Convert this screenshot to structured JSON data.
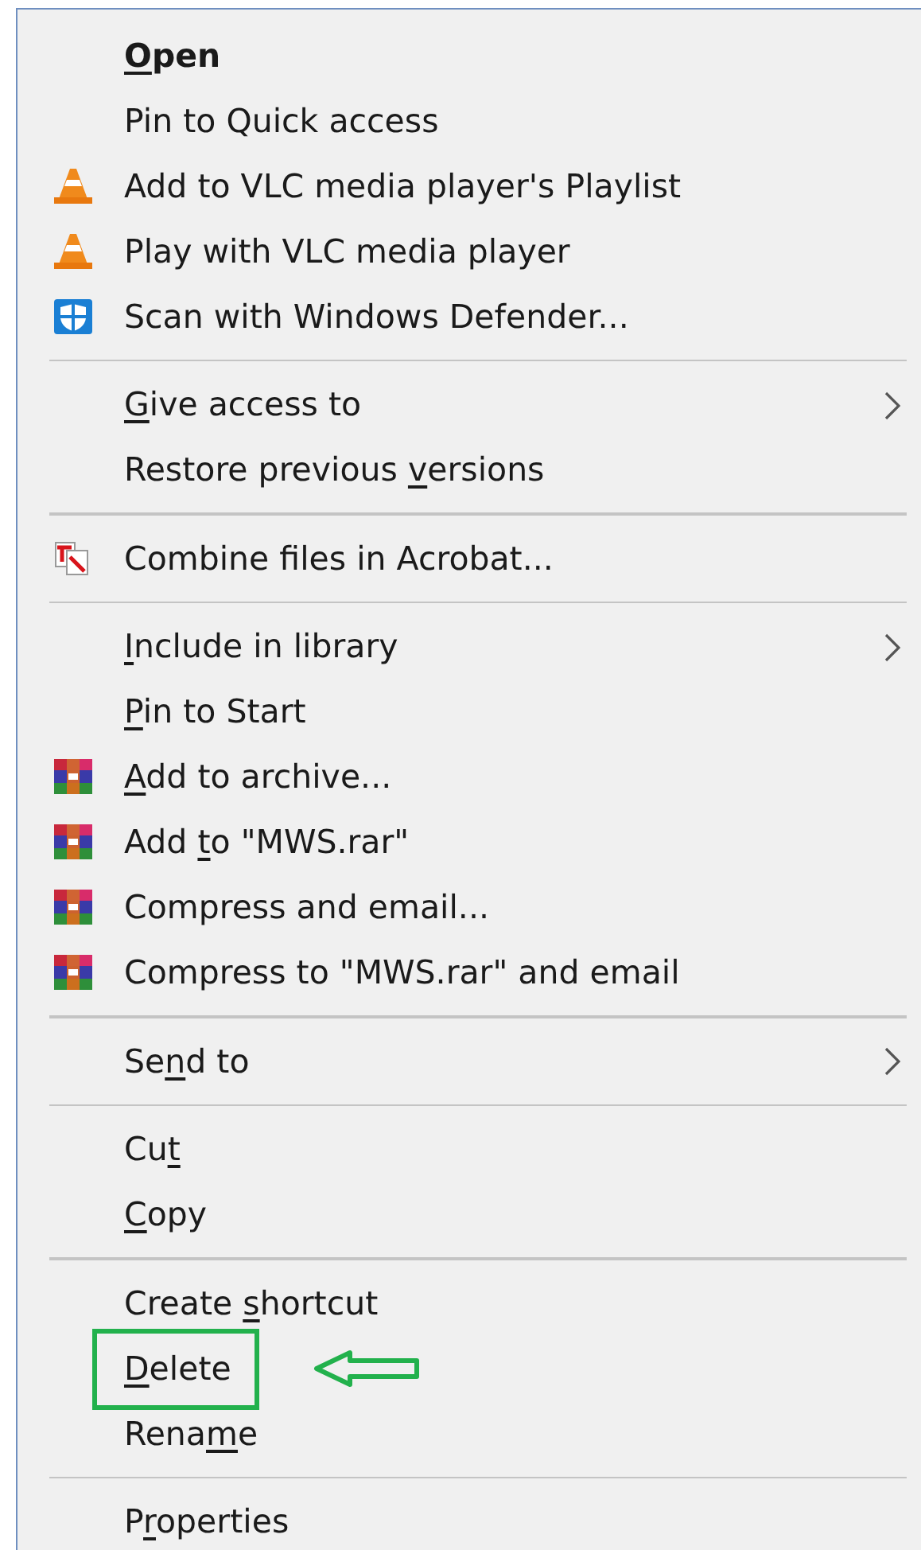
{
  "menu": {
    "groups": [
      {
        "items": [
          {
            "label": [
              {
                "text": "O",
                "underlined": true
              },
              {
                "text": "pen",
                "underlined": false
              }
            ],
            "bold": true,
            "submenu": false,
            "marked": false
          },
          {
            "label": [
              {
                "text": "Pin to Quick access",
                "underlined": false
              }
            ],
            "bold": false,
            "submenu": false,
            "marked": false
          },
          {
            "kind": "vlc",
            "label": [
              {
                "text": "Add to VLC media player's Playlist",
                "underlined": false
              }
            ],
            "bold": false,
            "submenu": false,
            "marked": false
          },
          {
            "kind": "vlc",
            "label": [
              {
                "text": "Play with VLC media player",
                "underlined": false
              }
            ],
            "bold": false,
            "submenu": false,
            "marked": false
          },
          {
            "kind": "defender",
            "label": [
              {
                "text": "Scan with Windows Defender...",
                "underlined": false
              }
            ],
            "bold": false,
            "submenu": false,
            "marked": false
          }
        ]
      },
      {
        "items": [
          {
            "label": [
              {
                "text": "G",
                "underlined": true
              },
              {
                "text": "ive access to",
                "underlined": false
              }
            ],
            "bold": false,
            "submenu": true,
            "marked": false
          },
          {
            "label": [
              {
                "text": "Restore previous ",
                "underlined": false
              },
              {
                "text": "v",
                "underlined": true
              },
              {
                "text": "ersions",
                "underlined": false
              }
            ],
            "bold": false,
            "submenu": false,
            "marked": false
          }
        ]
      },
      {
        "items": [
          {
            "kind": "acrobat",
            "label": [
              {
                "text": "Combine files in Acrobat...",
                "underlined": false
              }
            ],
            "bold": false,
            "submenu": false,
            "marked": false
          }
        ]
      },
      {
        "items": [
          {
            "label": [
              {
                "text": "I",
                "underlined": true
              },
              {
                "text": "nclude in library",
                "underlined": false
              }
            ],
            "bold": false,
            "submenu": true,
            "marked": false
          },
          {
            "label": [
              {
                "text": "P",
                "underlined": true
              },
              {
                "text": "in to Start",
                "underlined": false
              }
            ],
            "bold": false,
            "submenu": false,
            "marked": false
          },
          {
            "kind": "winrar",
            "label": [
              {
                "text": "A",
                "underlined": true
              },
              {
                "text": "dd to archive...",
                "underlined": false
              }
            ],
            "bold": false,
            "submenu": false,
            "marked": false
          },
          {
            "kind": "winrar",
            "label": [
              {
                "text": "Add ",
                "underlined": false
              },
              {
                "text": "t",
                "underlined": true
              },
              {
                "text": "o \"MWS.rar\"",
                "underlined": false
              }
            ],
            "bold": false,
            "submenu": false,
            "marked": false
          },
          {
            "kind": "winrar",
            "label": [
              {
                "text": "Compress and email...",
                "underlined": false
              }
            ],
            "bold": false,
            "submenu": false,
            "marked": false
          },
          {
            "kind": "winrar",
            "label": [
              {
                "text": "Compress to \"MWS.rar\" and email",
                "underlined": false
              }
            ],
            "bold": false,
            "submenu": false,
            "marked": false
          }
        ]
      },
      {
        "items": [
          {
            "label": [
              {
                "text": "Se",
                "underlined": false
              },
              {
                "text": "n",
                "underlined": true
              },
              {
                "text": "d to",
                "underlined": false
              }
            ],
            "bold": false,
            "submenu": true,
            "marked": false
          }
        ]
      },
      {
        "items": [
          {
            "label": [
              {
                "text": "Cu",
                "underlined": false
              },
              {
                "text": "t",
                "underlined": true
              }
            ],
            "bold": false,
            "submenu": false,
            "marked": false
          },
          {
            "label": [
              {
                "text": "C",
                "underlined": true
              },
              {
                "text": "opy",
                "underlined": false
              }
            ],
            "bold": false,
            "submenu": false,
            "marked": false
          }
        ]
      },
      {
        "items": [
          {
            "label": [
              {
                "text": "Create ",
                "underlined": false
              },
              {
                "text": "s",
                "underlined": true
              },
              {
                "text": "hortcut",
                "underlined": false
              }
            ],
            "bold": false,
            "submenu": false,
            "marked": false
          },
          {
            "label": [
              {
                "text": "D",
                "underlined": true
              },
              {
                "text": "elete",
                "underlined": false
              }
            ],
            "bold": false,
            "submenu": false,
            "marked": true
          },
          {
            "label": [
              {
                "text": "Rena",
                "underlined": false
              },
              {
                "text": "m",
                "underlined": true
              },
              {
                "text": "e",
                "underlined": false
              }
            ],
            "bold": false,
            "submenu": false,
            "marked": false
          }
        ]
      },
      {
        "items": [
          {
            "label": [
              {
                "text": "P",
                "underlined": false
              },
              {
                "text": "r",
                "underlined": true
              },
              {
                "text": "operties",
                "underlined": false
              }
            ],
            "bold": false,
            "submenu": false,
            "marked": false
          }
        ]
      }
    ]
  }
}
